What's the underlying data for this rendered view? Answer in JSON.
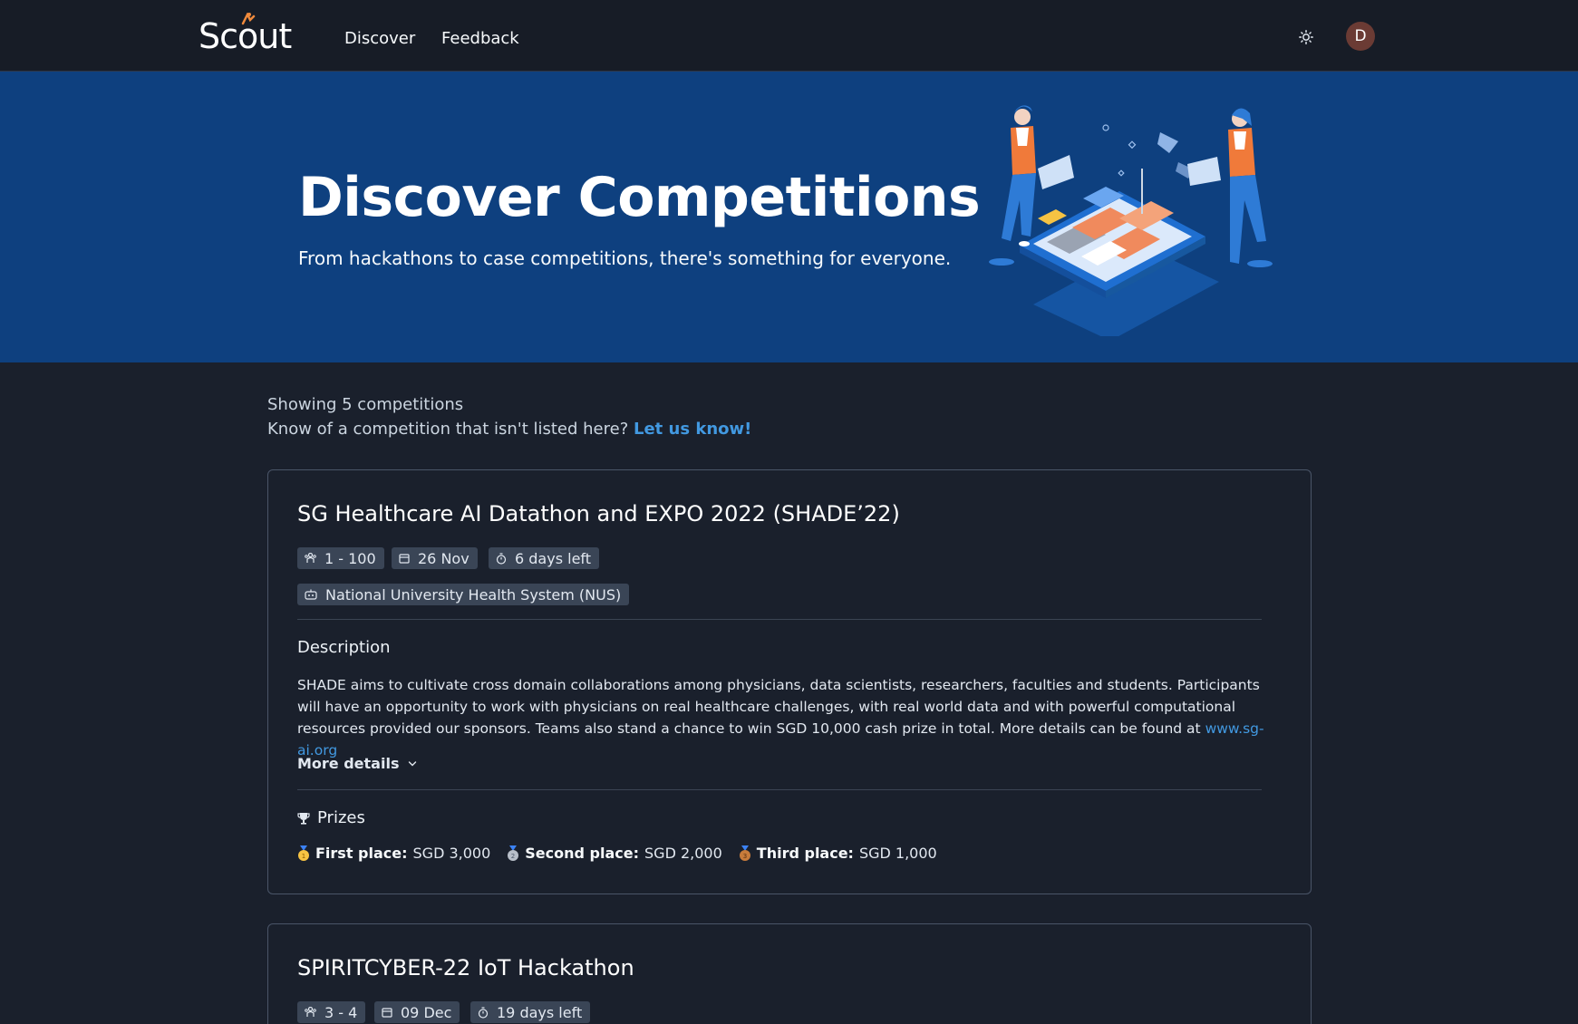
{
  "brand": {
    "logo_text_pre": "Sc",
    "logo_text_o": "o",
    "logo_text_post": "ut"
  },
  "nav": {
    "discover": "Discover",
    "feedback": "Feedback"
  },
  "user": {
    "avatar_initial": "D"
  },
  "hero": {
    "title": "Discover Competitions",
    "subtitle": "From hackathons to case competitions, there's something for everyone."
  },
  "listing": {
    "showing": "Showing 5 competitions",
    "know_of": "Know of a competition that isn't listed here?",
    "let_us_know": "Let us know!"
  },
  "competitions": [
    {
      "title": "SG Healthcare AI Datathon and EXPO 2022 (SHADE’22)",
      "team_size": "1 - 100",
      "date": "26 Nov",
      "time_left": "6 days left",
      "organizer": "National University Health System (NUS)",
      "description_heading": "Description",
      "description": "SHADE aims to cultivate cross domain collaborations among physicians, data scientists, researchers, faculties and students. Participants will have an opportunity to work with physicians on real healthcare challenges, with real world data and with powerful computational resources provided our sponsors. Teams also stand a chance to win SGD 10,000 cash prize in total. More details can be found at",
      "description_link": "www.sg-ai.org",
      "more_details": "More details",
      "prizes_heading": "Prizes",
      "prizes": [
        {
          "label": "First place:",
          "value": "SGD 3,000",
          "medal_color": "#f6c343"
        },
        {
          "label": "Second place:",
          "value": "SGD 2,000",
          "medal_color": "#b8bfc9"
        },
        {
          "label": "Third place:",
          "value": "SGD 1,000",
          "medal_color": "#c77b3b"
        }
      ]
    },
    {
      "title": "SPIRITCYBER-22 IoT Hackathon",
      "team_size": "3 - 4",
      "date": "09 Dec",
      "time_left": "19 days left"
    }
  ],
  "colors": {
    "navbar": "#171c26",
    "hero": "#0e407f",
    "background": "#1a202c",
    "link": "#4299e1"
  },
  "icons": [
    "sun-icon",
    "team-icon",
    "calendar-icon",
    "timer-icon",
    "organizer-icon",
    "chevron-down-icon",
    "trophy-icon",
    "medal-icon"
  ]
}
